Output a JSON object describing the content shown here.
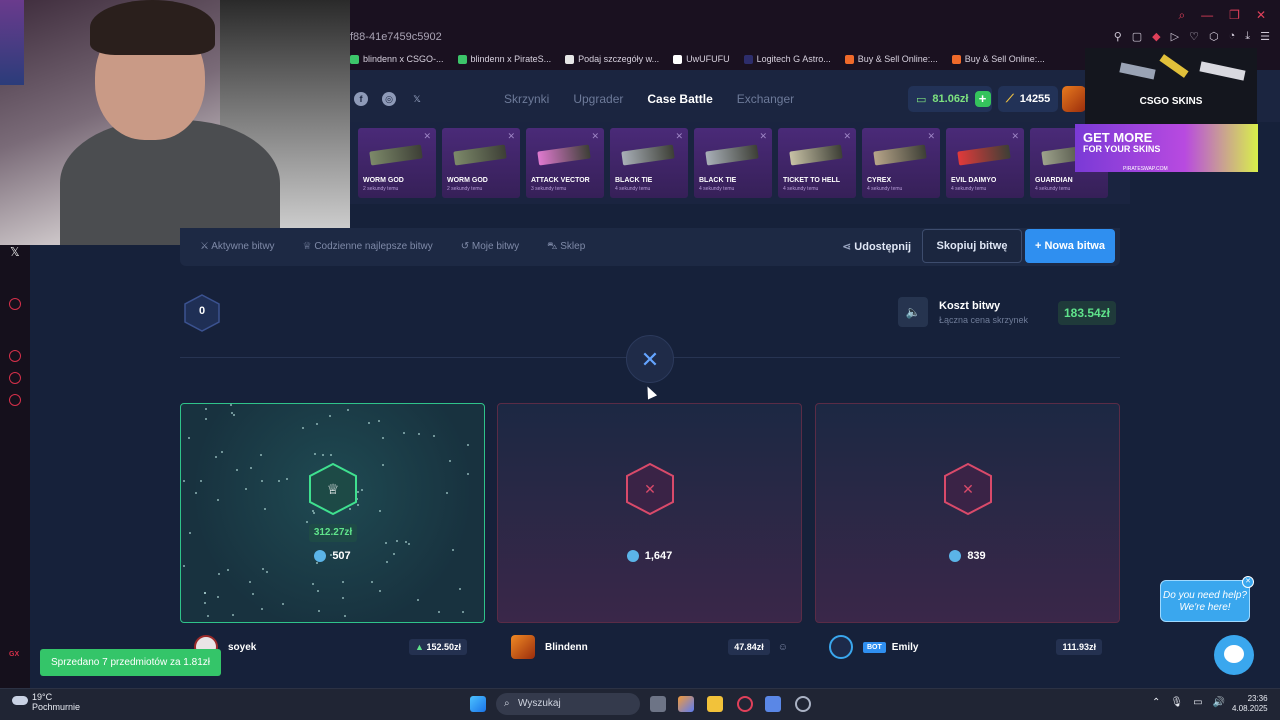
{
  "browser": {
    "url": "f88-41e7459c5902",
    "bookmarks": [
      {
        "label": "blindenn x CSGO-...",
        "color": "#3cc56a"
      },
      {
        "label": "blindenn x PirateS...",
        "color": "#3cc56a"
      },
      {
        "label": "Podaj szczegóły w...",
        "color": "#e6e6e6"
      },
      {
        "label": "UwUFUFU",
        "color": "#ffffff"
      },
      {
        "label": "Logitech G Astro...",
        "color": "#2d2d6b"
      },
      {
        "label": "Buy & Sell Online:...",
        "color": "#f06a2a"
      },
      {
        "label": "Buy & Sell Online:...",
        "color": "#f06a2a"
      }
    ]
  },
  "nav": {
    "tabs": [
      "Skrzynki",
      "Upgrader",
      "Case Battle",
      "Exchanger"
    ],
    "active_tab": "Case Battle",
    "balance": "81.06zł",
    "coins": "14255"
  },
  "drops": [
    {
      "name": "WORM GOD",
      "sub": "2 sekundy temu"
    },
    {
      "name": "WORM GOD",
      "sub": "2 sekundy temu"
    },
    {
      "name": "ATTACK VECTOR",
      "sub": "3 sekundy temu"
    },
    {
      "name": "BLACK TIE",
      "sub": "4 sekundy temu"
    },
    {
      "name": "BLACK TIE",
      "sub": "4 sekundy temu"
    },
    {
      "name": "TICKET TO HELL",
      "sub": "4 sekundy temu"
    },
    {
      "name": "CYREX",
      "sub": "4 sekundy temu"
    },
    {
      "name": "EVIL DAIMYO",
      "sub": "4 sekundy temu"
    },
    {
      "name": "GUARDIAN",
      "sub": "4 sekundy temu"
    }
  ],
  "ad": {
    "brand": "CSGO SKINS",
    "headline1": "GET MORE",
    "headline2": "FOR YOUR SKINS",
    "site": "PIRATESWAP.COM"
  },
  "battle_bar": {
    "links": [
      "Aktywne bitwy",
      "Codzienne najlepsze bitwy",
      "Moje bitwy",
      "Sklep"
    ],
    "share": "Udostępnij",
    "copy": "Skopiuj bitwę",
    "new": "+ Nowa bitwa"
  },
  "round": "0",
  "cost": {
    "title": "Koszt bitwy",
    "subtitle": "Łączna cena skrzynek",
    "value": "183.54zł"
  },
  "players": [
    {
      "name": "soyek",
      "amount": "507",
      "win_value": "312.27zł",
      "total": "152.50zł",
      "winner": true
    },
    {
      "name": "Blindenn",
      "amount": "1,647",
      "total": "47.84zł",
      "winner": false
    },
    {
      "name": "Emily",
      "amount": "839",
      "total": "111.93zł",
      "winner": false,
      "bot": "BOT"
    }
  ],
  "toast": "Sprzedano 7 przedmiotów za 1.81zł",
  "help": {
    "line1": "Do you need help?",
    "line2": "We're here!"
  },
  "taskbar": {
    "temp": "19°C",
    "weather": "Pochmurnie",
    "search": "Wyszukaj",
    "time": "23:36",
    "date": "4.08.2025"
  },
  "colors": {
    "accent": "#2f8ff0",
    "win": "#5fe38b",
    "lose": "#d94a6a"
  }
}
